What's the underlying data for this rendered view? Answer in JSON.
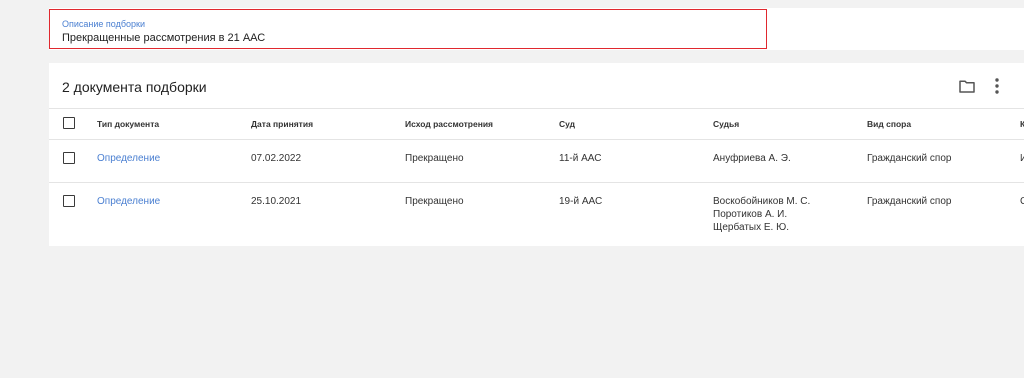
{
  "description": {
    "label": "Описание подборки",
    "value": "Прекращенные рассмотрения в 21 ААС"
  },
  "card": {
    "title": "2 документа подборки",
    "icons": [
      "folder-icon",
      "more-vertical-icon"
    ]
  },
  "table": {
    "columns": [
      "Тип документа",
      "Дата принятия",
      "Исход рассмотрения",
      "Суд",
      "Судья",
      "Вид спора",
      "К"
    ],
    "rows": [
      {
        "type": "Определение",
        "date": "07.02.2022",
        "outcome": "Прекращено",
        "court": "11-й ААС",
        "judges": [
          "Ануфриева А. Э."
        ],
        "dispute": "Гражданский спор",
        "extra": "И"
      },
      {
        "type": "Определение",
        "date": "25.10.2021",
        "outcome": "Прекращено",
        "court": "19-й ААС",
        "judges": [
          "Воскобойников М. С.",
          "Поротиков А. И.",
          "Щербатых Е. Ю."
        ],
        "dispute": "Гражданский спор",
        "extra": "С"
      }
    ]
  },
  "colors": {
    "accent": "#4a7fd1",
    "highlight_border": "#e0282e",
    "background": "#f2f2f2"
  }
}
